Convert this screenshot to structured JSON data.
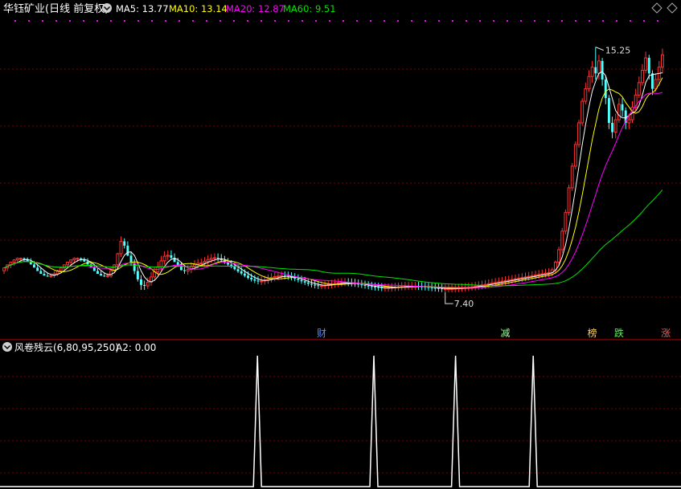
{
  "header": {
    "title": "华钰矿业(日线 前复权)",
    "ma5": "MA5: 13.77",
    "ma10": "MA10: 13.14",
    "ma20": "MA20: 12.87",
    "ma60": "MA60: 9.51"
  },
  "indicator": {
    "title": "风卷残云(6,80,95,250)",
    "a2": "A2: 0.00"
  },
  "colors": {
    "up": "#ff3232",
    "down": "#54ffff",
    "ma5": "#ffffff",
    "ma10": "#ffff00",
    "ma20": "#ff00ff",
    "ma60": "#00e600",
    "grid": "#7a0000",
    "divider": "#c00000"
  },
  "chart_data": [
    {
      "type": "candlestick",
      "price_range": [
        6.0,
        16.2
      ],
      "high_annotation": "15.25",
      "low_annotation": "7.40",
      "event_markers": [
        {
          "label": "财",
          "index": 95,
          "color": "#5a8cff"
        },
        {
          "label": "减",
          "index": 150,
          "color": "#9bff9b"
        },
        {
          "label": "榜",
          "index": 176,
          "color": "#ffd060"
        },
        {
          "label": "跌",
          "index": 184,
          "color": "#4cff4c"
        },
        {
          "label": "涨",
          "index": 198,
          "color": "#ff5050"
        }
      ],
      "candles": [
        [
          8.02,
          8.11,
          7.92,
          8.13
        ],
        [
          8.11,
          8.21,
          8.01,
          8.22
        ],
        [
          8.21,
          8.3,
          8.1,
          8.31
        ],
        [
          8.3,
          8.37,
          8.19,
          8.39
        ],
        [
          8.37,
          8.42,
          8.26,
          8.45
        ],
        [
          8.42,
          8.42,
          8.31,
          8.45
        ],
        [
          8.42,
          8.39,
          8.32,
          8.45
        ],
        [
          8.39,
          8.32,
          8.3,
          8.45
        ],
        [
          8.32,
          8.22,
          8.24,
          8.42
        ],
        [
          8.22,
          8.12,
          8.15,
          8.33
        ],
        [
          8.12,
          8.01,
          8.04,
          8.23
        ],
        [
          8.01,
          7.92,
          7.94,
          8.13
        ],
        [
          7.92,
          7.86,
          7.88,
          8.03
        ],
        [
          7.86,
          7.84,
          7.82,
          7.96
        ],
        [
          7.84,
          7.86,
          7.79,
          7.94
        ],
        [
          7.86,
          7.92,
          7.79,
          8.01
        ],
        [
          7.92,
          8.02,
          7.85,
          8.05
        ],
        [
          8.02,
          8.11,
          7.95,
          8.13
        ],
        [
          8.11,
          8.21,
          8.01,
          8.22
        ],
        [
          8.21,
          8.3,
          8.1,
          8.31
        ],
        [
          8.3,
          8.37,
          8.19,
          8.39
        ],
        [
          8.37,
          8.42,
          8.26,
          8.45
        ],
        [
          8.42,
          8.42,
          8.31,
          8.45
        ],
        [
          8.42,
          8.39,
          8.32,
          8.45
        ],
        [
          8.39,
          8.32,
          8.3,
          8.45
        ],
        [
          8.32,
          8.22,
          8.24,
          8.42
        ],
        [
          8.22,
          8.12,
          8.15,
          8.33
        ],
        [
          8.12,
          8.01,
          8.04,
          8.23
        ],
        [
          8.01,
          7.92,
          7.94,
          8.13
        ],
        [
          7.92,
          7.86,
          7.88,
          8.03
        ],
        [
          7.86,
          7.84,
          7.82,
          7.96
        ],
        [
          7.84,
          7.86,
          7.79,
          7.94
        ],
        [
          7.86,
          8.02,
          7.79,
          8.11
        ],
        [
          8.02,
          8.21,
          7.95,
          8.23
        ],
        [
          8.21,
          8.57,
          8.1,
          8.6
        ],
        [
          8.57,
          8.97,
          8.46,
          9.13
        ],
        [
          8.97,
          8.83,
          8.74,
          9.07
        ],
        [
          8.83,
          8.51,
          8.49,
          8.97
        ],
        [
          8.51,
          8.25,
          8.18,
          8.65
        ],
        [
          8.25,
          8.01,
          7.91,
          8.39
        ],
        [
          8.01,
          7.74,
          7.67,
          8.15
        ],
        [
          7.74,
          7.56,
          7.4,
          7.88
        ],
        [
          7.56,
          7.53,
          7.4,
          7.7
        ],
        [
          7.53,
          7.65,
          7.43,
          7.8
        ],
        [
          7.65,
          7.82,
          7.53,
          7.98
        ],
        [
          7.82,
          7.98,
          7.7,
          8.14
        ],
        [
          7.98,
          8.15,
          7.86,
          8.31
        ],
        [
          8.15,
          8.34,
          8.03,
          8.5
        ],
        [
          8.34,
          8.49,
          8.22,
          8.65
        ],
        [
          8.49,
          8.52,
          8.37,
          8.68
        ],
        [
          8.52,
          8.44,
          8.4,
          8.68
        ],
        [
          8.44,
          8.3,
          8.32,
          8.58
        ],
        [
          8.3,
          8.15,
          8.18,
          8.44
        ],
        [
          8.15,
          8.04,
          8.03,
          8.3
        ],
        [
          8.04,
          8.01,
          7.92,
          8.17
        ],
        [
          8.01,
          8.06,
          7.89,
          8.2
        ],
        [
          8.06,
          8.15,
          7.94,
          8.29
        ],
        [
          8.15,
          8.22,
          8.03,
          8.36
        ],
        [
          8.22,
          8.26,
          8.1,
          8.4
        ],
        [
          8.26,
          8.27,
          8.14,
          8.41
        ],
        [
          8.27,
          8.32,
          8.15,
          8.46
        ],
        [
          8.32,
          8.38,
          8.2,
          8.52
        ],
        [
          8.38,
          8.42,
          8.26,
          8.56
        ],
        [
          8.42,
          8.44,
          8.3,
          8.58
        ],
        [
          8.44,
          8.42,
          8.32,
          8.58
        ],
        [
          8.42,
          8.36,
          8.3,
          8.56
        ],
        [
          8.36,
          8.29,
          8.24,
          8.5
        ],
        [
          8.29,
          8.22,
          8.17,
          8.43
        ],
        [
          8.22,
          8.15,
          8.1,
          8.36
        ],
        [
          8.15,
          8.07,
          8.03,
          8.29
        ],
        [
          8.07,
          8.0,
          7.95,
          8.21
        ],
        [
          8.0,
          7.93,
          7.88,
          8.14
        ],
        [
          7.93,
          7.86,
          7.81,
          8.07
        ],
        [
          7.86,
          7.79,
          7.74,
          8.0
        ],
        [
          7.79,
          7.74,
          7.67,
          7.93
        ],
        [
          7.74,
          7.7,
          7.62,
          7.88
        ],
        [
          7.7,
          7.68,
          7.58,
          7.84
        ],
        [
          7.68,
          7.69,
          7.56,
          7.83
        ],
        [
          7.69,
          7.72,
          7.57,
          7.86
        ],
        [
          7.72,
          7.76,
          7.6,
          7.9
        ],
        [
          7.76,
          7.8,
          7.64,
          7.94
        ],
        [
          7.8,
          7.83,
          7.68,
          7.97
        ],
        [
          7.83,
          7.85,
          7.71,
          7.99
        ],
        [
          7.85,
          7.86,
          7.73,
          8.0
        ],
        [
          7.86,
          7.85,
          7.74,
          8.0
        ],
        [
          7.85,
          7.83,
          7.73,
          7.99
        ],
        [
          7.83,
          7.8,
          7.71,
          7.97
        ],
        [
          7.8,
          7.76,
          7.68,
          7.94
        ],
        [
          7.76,
          7.72,
          7.64,
          7.9
        ],
        [
          7.72,
          7.68,
          7.6,
          7.86
        ],
        [
          7.68,
          7.64,
          7.56,
          7.82
        ],
        [
          7.64,
          7.6,
          7.52,
          7.78
        ],
        [
          7.6,
          7.57,
          7.48,
          7.74
        ],
        [
          7.57,
          7.55,
          7.45,
          7.71
        ],
        [
          7.55,
          7.54,
          7.43,
          7.69
        ],
        [
          7.54,
          7.54,
          7.42,
          7.68
        ],
        [
          7.54,
          7.55,
          7.42,
          7.69
        ],
        [
          7.55,
          7.57,
          7.43,
          7.71
        ],
        [
          7.57,
          7.59,
          7.45,
          7.73
        ],
        [
          7.59,
          7.61,
          7.47,
          7.75
        ],
        [
          7.61,
          7.63,
          7.49,
          7.77
        ],
        [
          7.63,
          7.64,
          7.51,
          7.78
        ],
        [
          7.64,
          7.64,
          7.52,
          7.78
        ],
        [
          7.64,
          7.63,
          7.52,
          7.78
        ],
        [
          7.63,
          7.62,
          7.51,
          7.77
        ],
        [
          7.62,
          7.6,
          7.5,
          7.76
        ],
        [
          7.6,
          7.58,
          7.48,
          7.74
        ],
        [
          7.58,
          7.56,
          7.46,
          7.72
        ],
        [
          7.56,
          7.54,
          7.44,
          7.7
        ],
        [
          7.54,
          7.52,
          7.42,
          7.68
        ],
        [
          7.52,
          7.5,
          7.4,
          7.66
        ],
        [
          7.5,
          7.49,
          7.38,
          7.64
        ],
        [
          7.49,
          7.48,
          7.37,
          7.63
        ],
        [
          7.48,
          7.47,
          7.36,
          7.62
        ],
        [
          7.47,
          7.47,
          7.35,
          7.61
        ],
        [
          7.47,
          7.47,
          7.35,
          7.61
        ],
        [
          7.47,
          7.48,
          7.35,
          7.62
        ],
        [
          7.48,
          7.49,
          7.36,
          7.63
        ],
        [
          7.49,
          7.5,
          7.37,
          7.64
        ],
        [
          7.5,
          7.51,
          7.38,
          7.65
        ],
        [
          7.51,
          7.52,
          7.39,
          7.66
        ],
        [
          7.52,
          7.52,
          7.4,
          7.66
        ],
        [
          7.52,
          7.52,
          7.4,
          7.66
        ],
        [
          7.52,
          7.52,
          7.4,
          7.66
        ],
        [
          7.52,
          7.51,
          7.4,
          7.66
        ],
        [
          7.51,
          7.5,
          7.39,
          7.65
        ],
        [
          7.5,
          7.49,
          7.38,
          7.64
        ],
        [
          7.49,
          7.48,
          7.37,
          7.63
        ],
        [
          7.48,
          7.47,
          7.36,
          7.62
        ],
        [
          7.47,
          7.46,
          7.35,
          7.61
        ],
        [
          7.46,
          7.45,
          7.34,
          7.6
        ],
        [
          7.45,
          7.44,
          7.33,
          7.59
        ],
        [
          7.44,
          7.44,
          7.32,
          7.58
        ],
        [
          7.44,
          7.44,
          7.32,
          7.58
        ],
        [
          7.44,
          7.44,
          7.32,
          7.58
        ],
        [
          7.44,
          7.45,
          7.32,
          7.59
        ],
        [
          7.45,
          7.46,
          7.33,
          7.6
        ],
        [
          7.46,
          7.47,
          7.34,
          7.61
        ],
        [
          7.47,
          7.48,
          7.35,
          7.62
        ],
        [
          7.48,
          7.49,
          7.36,
          7.63
        ],
        [
          7.49,
          7.5,
          7.37,
          7.64
        ],
        [
          7.5,
          7.52,
          7.38,
          7.66
        ],
        [
          7.52,
          7.54,
          7.4,
          7.68
        ],
        [
          7.54,
          7.56,
          7.42,
          7.7
        ],
        [
          7.56,
          7.58,
          7.44,
          7.72
        ],
        [
          7.58,
          7.6,
          7.46,
          7.74
        ],
        [
          7.6,
          7.62,
          7.48,
          7.76
        ],
        [
          7.62,
          7.64,
          7.5,
          7.78
        ],
        [
          7.64,
          7.66,
          7.52,
          7.8
        ],
        [
          7.66,
          7.68,
          7.54,
          7.82
        ],
        [
          7.68,
          7.7,
          7.56,
          7.84
        ],
        [
          7.7,
          7.72,
          7.58,
          7.86
        ],
        [
          7.72,
          7.74,
          7.6,
          7.88
        ],
        [
          7.74,
          7.76,
          7.62,
          7.9
        ],
        [
          7.76,
          7.78,
          7.64,
          7.92
        ],
        [
          7.78,
          7.8,
          7.66,
          7.94
        ],
        [
          7.8,
          7.82,
          7.68,
          7.96
        ],
        [
          7.82,
          7.84,
          7.7,
          7.98
        ],
        [
          7.84,
          7.86,
          7.72,
          8.0
        ],
        [
          7.86,
          7.88,
          7.74,
          8.02
        ],
        [
          7.88,
          7.9,
          7.76,
          8.04
        ],
        [
          7.9,
          7.92,
          7.78,
          8.06
        ],
        [
          7.92,
          7.94,
          7.8,
          8.08
        ],
        [
          7.94,
          7.96,
          7.82,
          8.1
        ],
        [
          7.96,
          8.05,
          7.84,
          8.12
        ],
        [
          8.05,
          8.3,
          7.93,
          8.35
        ],
        [
          8.3,
          8.7,
          8.2,
          8.8
        ],
        [
          8.7,
          9.3,
          8.6,
          9.4
        ],
        [
          9.3,
          9.9,
          9.2,
          10.0
        ],
        [
          9.9,
          10.7,
          9.8,
          10.8
        ],
        [
          10.7,
          11.4,
          10.6,
          11.5
        ],
        [
          11.4,
          12.1,
          11.3,
          12.2
        ],
        [
          12.1,
          12.8,
          12.0,
          12.9
        ],
        [
          12.8,
          13.5,
          12.7,
          13.6
        ],
        [
          13.5,
          13.9,
          13.4,
          14.1
        ],
        [
          13.9,
          14.3,
          13.8,
          14.5
        ],
        [
          14.3,
          14.6,
          14.1,
          14.8
        ],
        [
          14.6,
          14.4,
          14.2,
          15.25
        ],
        [
          14.4,
          14.8,
          14.2,
          15.0
        ],
        [
          14.8,
          14.2,
          14.0,
          14.9
        ],
        [
          14.2,
          13.6,
          13.4,
          14.3
        ],
        [
          13.6,
          12.8,
          12.6,
          13.7
        ],
        [
          12.8,
          12.5,
          12.3,
          13.0
        ],
        [
          12.5,
          12.9,
          12.3,
          13.1
        ],
        [
          12.9,
          13.4,
          12.8,
          13.6
        ],
        [
          13.4,
          13.2,
          13.0,
          13.6
        ],
        [
          13.2,
          12.8,
          12.6,
          13.3
        ],
        [
          12.8,
          12.9,
          12.6,
          13.1
        ],
        [
          12.9,
          13.3,
          12.8,
          13.5
        ],
        [
          13.3,
          13.7,
          13.2,
          13.9
        ],
        [
          13.7,
          14.1,
          13.6,
          14.3
        ],
        [
          14.1,
          14.5,
          14.0,
          14.7
        ],
        [
          14.5,
          14.9,
          14.4,
          15.1
        ],
        [
          14.9,
          14.4,
          14.2,
          15.0
        ],
        [
          14.4,
          13.9,
          13.7,
          14.5
        ],
        [
          13.9,
          14.2,
          13.8,
          14.4
        ],
        [
          14.2,
          14.6,
          14.0,
          14.8
        ],
        [
          14.6,
          15.0,
          14.4,
          15.2
        ]
      ]
    },
    {
      "type": "line",
      "name": "风卷残云",
      "signal_positions": [
        0.378,
        0.549,
        0.669,
        0.783
      ],
      "value_range": [
        0,
        1
      ]
    }
  ]
}
